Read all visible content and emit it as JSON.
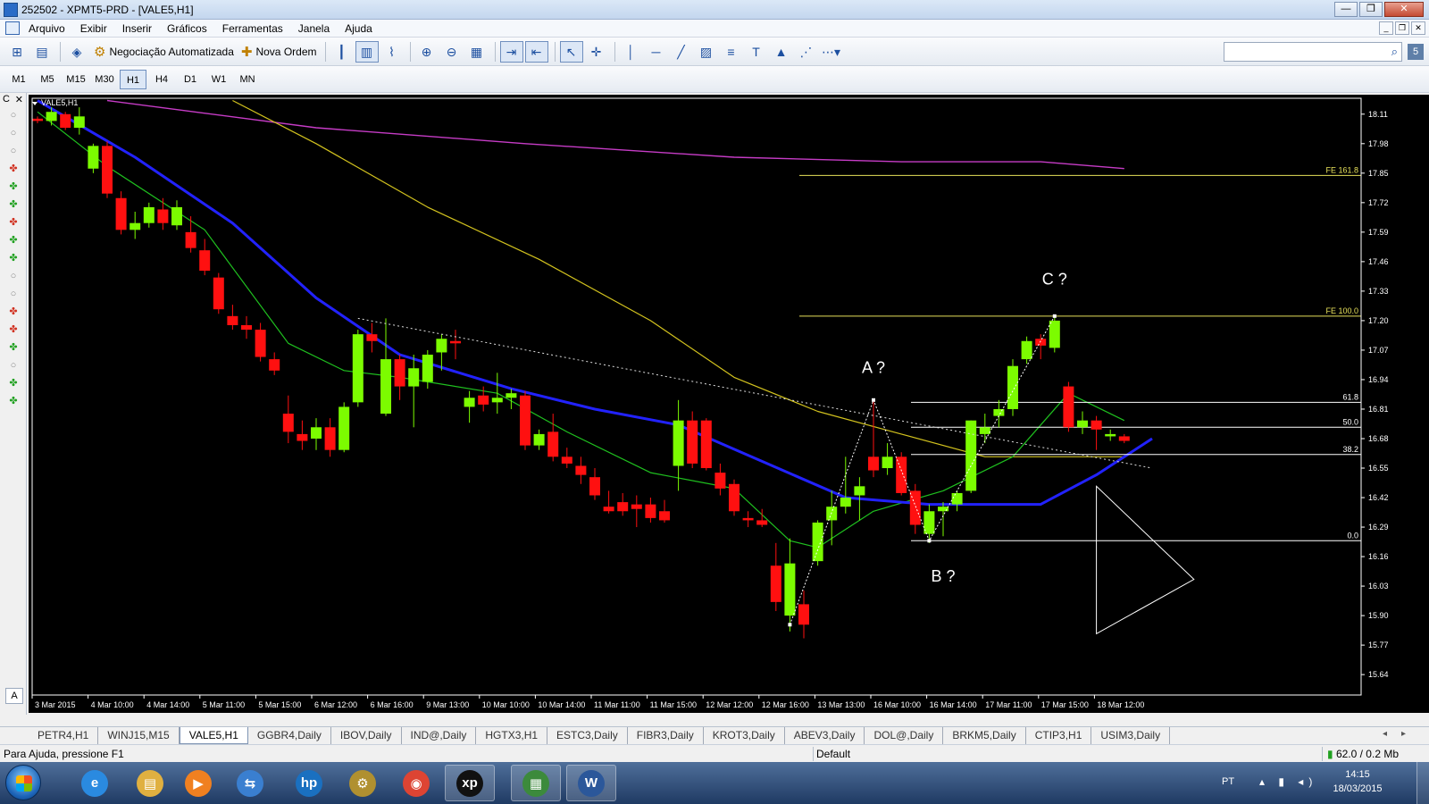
{
  "window": {
    "title": "252502 - XPMT5-PRD - [VALE5,H1]",
    "controls": {
      "minimize": "—",
      "maximize": "❐",
      "close": "✕"
    }
  },
  "menubar": {
    "items": [
      "Arquivo",
      "Exibir",
      "Inserir",
      "Gráficos",
      "Ferramentas",
      "Janela",
      "Ajuda"
    ],
    "mdi_controls": {
      "minimize": "_",
      "restore": "❐",
      "close": "✕"
    }
  },
  "toolbar": {
    "auto_trading_label": "Negociação Automatizada",
    "new_order_label": "Nova Ordem",
    "search_placeholder": "",
    "search_icon": "search-icon",
    "help_label": "5"
  },
  "timeframes": {
    "items": [
      "M1",
      "M5",
      "M15",
      "M30",
      "H1",
      "H4",
      "D1",
      "W1",
      "MN"
    ],
    "active": "H1"
  },
  "left_panel": {
    "header_label": "C",
    "close_label": "✕",
    "bottom_label": "A"
  },
  "chart_data": {
    "type": "candlestick",
    "symbol_label": "VALE5,H1",
    "ylim": [
      15.55,
      18.18
    ],
    "y_ticks": [
      "18.11",
      "17.98",
      "17.85",
      "17.72",
      "17.59",
      "17.46",
      "17.33",
      "17.20",
      "17.07",
      "16.94",
      "16.81",
      "16.68",
      "16.55",
      "16.42",
      "16.29",
      "16.16",
      "16.03",
      "15.90",
      "15.77",
      "15.64"
    ],
    "x_ticks": [
      "3 Mar 2015",
      "4 Mar 10:00",
      "4 Mar 14:00",
      "5 Mar 11:00",
      "5 Mar 15:00",
      "6 Mar 12:00",
      "6 Mar 16:00",
      "9 Mar 13:00",
      "10 Mar 10:00",
      "10 Mar 14:00",
      "11 Mar 11:00",
      "11 Mar 15:00",
      "12 Mar 12:00",
      "12 Mar 16:00",
      "13 Mar 13:00",
      "16 Mar 10:00",
      "16 Mar 14:00",
      "17 Mar 11:00",
      "17 Mar 15:00",
      "18 Mar 12:00"
    ],
    "candles": [
      [
        18.09,
        18.1,
        18.07,
        18.08
      ],
      [
        18.08,
        18.14,
        18.06,
        18.12
      ],
      [
        18.11,
        18.12,
        18.04,
        18.05
      ],
      [
        18.05,
        18.14,
        18.02,
        18.1
      ],
      [
        17.87,
        17.98,
        17.85,
        17.97
      ],
      [
        17.97,
        17.99,
        17.74,
        17.76
      ],
      [
        17.74,
        17.77,
        17.58,
        17.6
      ],
      [
        17.6,
        17.68,
        17.56,
        17.63
      ],
      [
        17.63,
        17.72,
        17.61,
        17.7
      ],
      [
        17.69,
        17.74,
        17.6,
        17.63
      ],
      [
        17.62,
        17.73,
        17.6,
        17.7
      ],
      [
        17.59,
        17.66,
        17.5,
        17.52
      ],
      [
        17.51,
        17.56,
        17.4,
        17.42
      ],
      [
        17.39,
        17.41,
        17.23,
        17.25
      ],
      [
        17.22,
        17.27,
        17.16,
        17.18
      ],
      [
        17.18,
        17.22,
        17.12,
        17.16
      ],
      [
        17.16,
        17.19,
        17.02,
        17.04
      ],
      [
        17.03,
        17.06,
        16.96,
        16.98
      ],
      [
        16.79,
        16.87,
        16.66,
        16.71
      ],
      [
        16.7,
        16.76,
        16.63,
        16.67
      ],
      [
        16.68,
        16.77,
        16.63,
        16.73
      ],
      [
        16.73,
        16.77,
        16.6,
        16.63
      ],
      [
        16.63,
        16.84,
        16.62,
        16.82
      ],
      [
        16.84,
        17.16,
        16.82,
        17.14
      ],
      [
        17.14,
        17.19,
        17.06,
        17.11
      ],
      [
        16.79,
        17.21,
        16.78,
        17.03
      ],
      [
        17.03,
        17.05,
        16.85,
        16.91
      ],
      [
        16.91,
        17.05,
        16.73,
        16.99
      ],
      [
        16.93,
        17.07,
        16.9,
        17.05
      ],
      [
        17.06,
        17.14,
        16.98,
        17.12
      ],
      [
        17.11,
        17.16,
        17.03,
        17.1
      ],
      [
        16.82,
        16.89,
        16.75,
        16.86
      ],
      [
        16.87,
        16.91,
        16.8,
        16.83
      ],
      [
        16.84,
        16.97,
        16.79,
        16.86
      ],
      [
        16.86,
        16.9,
        16.81,
        16.88
      ],
      [
        16.87,
        16.89,
        16.63,
        16.65
      ],
      [
        16.65,
        16.72,
        16.63,
        16.7
      ],
      [
        16.71,
        16.79,
        16.58,
        16.6
      ],
      [
        16.6,
        16.64,
        16.55,
        16.57
      ],
      [
        16.56,
        16.6,
        16.48,
        16.52
      ],
      [
        16.51,
        16.55,
        16.41,
        16.43
      ],
      [
        16.38,
        16.45,
        16.35,
        16.36
      ],
      [
        16.4,
        16.44,
        16.34,
        16.36
      ],
      [
        16.39,
        16.43,
        16.29,
        16.37
      ],
      [
        16.39,
        16.42,
        16.31,
        16.33
      ],
      [
        16.36,
        16.41,
        16.31,
        16.32
      ],
      [
        16.56,
        16.85,
        16.45,
        16.76
      ],
      [
        16.76,
        16.8,
        16.55,
        16.57
      ],
      [
        16.76,
        16.77,
        16.54,
        16.55
      ],
      [
        16.53,
        16.57,
        16.43,
        16.46
      ],
      [
        16.48,
        16.5,
        16.34,
        16.36
      ],
      [
        16.33,
        16.36,
        16.29,
        16.32
      ],
      [
        16.32,
        16.37,
        16.29,
        16.3
      ],
      [
        16.12,
        16.22,
        15.92,
        15.96
      ],
      [
        15.9,
        16.24,
        15.83,
        16.13
      ],
      [
        15.95,
        16.01,
        15.8,
        15.86
      ],
      [
        16.14,
        16.32,
        16.12,
        16.31
      ],
      [
        16.32,
        16.45,
        16.21,
        16.38
      ],
      [
        16.38,
        16.6,
        16.35,
        16.42
      ],
      [
        16.43,
        16.51,
        16.32,
        16.47
      ],
      [
        16.6,
        16.85,
        16.51,
        16.54
      ],
      [
        16.55,
        16.66,
        16.52,
        16.6
      ],
      [
        16.6,
        16.62,
        16.43,
        16.44
      ],
      [
        16.45,
        16.48,
        16.26,
        16.3
      ],
      [
        16.26,
        16.39,
        16.22,
        16.36
      ],
      [
        16.36,
        16.4,
        16.25,
        16.38
      ],
      [
        16.39,
        16.45,
        16.36,
        16.44
      ],
      [
        16.45,
        16.76,
        16.44,
        16.76
      ],
      [
        16.7,
        16.79,
        16.66,
        16.73
      ],
      [
        16.78,
        16.85,
        16.73,
        16.81
      ],
      [
        16.81,
        17.03,
        16.78,
        17.0
      ],
      [
        17.03,
        17.13,
        17.01,
        17.11
      ],
      [
        17.12,
        17.14,
        17.03,
        17.09
      ],
      [
        17.08,
        17.22,
        17.06,
        17.2
      ],
      [
        16.91,
        16.93,
        16.71,
        16.73
      ],
      [
        16.73,
        16.8,
        16.7,
        16.76
      ],
      [
        16.76,
        16.78,
        16.63,
        16.72
      ],
      [
        16.69,
        16.72,
        16.67,
        16.7
      ],
      [
        16.69,
        16.7,
        16.66,
        16.67
      ]
    ],
    "ma_blue": [
      [
        0,
        18.17
      ],
      [
        7,
        17.92
      ],
      [
        14,
        17.63
      ],
      [
        20,
        17.3
      ],
      [
        26,
        17.05
      ],
      [
        34,
        16.9
      ],
      [
        40,
        16.81
      ],
      [
        46,
        16.74
      ],
      [
        52,
        16.58
      ],
      [
        58,
        16.42
      ],
      [
        64,
        16.39
      ],
      [
        72,
        16.39
      ],
      [
        76,
        16.52
      ],
      [
        80,
        16.68
      ]
    ],
    "ma_green": [
      [
        0,
        18.12
      ],
      [
        5,
        17.88
      ],
      [
        12,
        17.6
      ],
      [
        18,
        17.1
      ],
      [
        22,
        16.98
      ],
      [
        26,
        16.95
      ],
      [
        33,
        16.88
      ],
      [
        38,
        16.71
      ],
      [
        44,
        16.53
      ],
      [
        50,
        16.46
      ],
      [
        54,
        16.23
      ],
      [
        56,
        16.2
      ],
      [
        60,
        16.36
      ],
      [
        65,
        16.45
      ],
      [
        70,
        16.6
      ],
      [
        74,
        16.88
      ],
      [
        78,
        16.76
      ]
    ],
    "ma_yellow": [
      [
        14,
        18.17
      ],
      [
        20,
        17.98
      ],
      [
        28,
        17.7
      ],
      [
        36,
        17.47
      ],
      [
        44,
        17.2
      ],
      [
        50,
        16.95
      ],
      [
        56,
        16.8
      ],
      [
        62,
        16.7
      ],
      [
        68,
        16.6
      ],
      [
        74,
        16.6
      ],
      [
        78,
        16.6
      ]
    ],
    "ma_magenta": [
      [
        5,
        18.17
      ],
      [
        20,
        18.05
      ],
      [
        35,
        17.98
      ],
      [
        50,
        17.92
      ],
      [
        62,
        17.9
      ],
      [
        72,
        17.9
      ],
      [
        78,
        17.87
      ]
    ],
    "trendline_dotted": [
      [
        23,
        17.21
      ],
      [
        80,
        16.55
      ]
    ],
    "zigzag": [
      [
        54,
        15.86
      ],
      [
        60,
        16.85
      ],
      [
        64,
        16.23
      ],
      [
        73,
        17.22
      ]
    ],
    "fibonacci_levels": [
      {
        "label": "FE 161.8",
        "value": 17.84
      },
      {
        "label": "FE 100.0",
        "value": 17.22
      },
      {
        "label": "61.8",
        "value": 16.84
      },
      {
        "label": "50.0",
        "value": 16.73
      },
      {
        "label": "38.2",
        "value": 16.61
      },
      {
        "label": "0.0",
        "value": 16.23
      }
    ],
    "annotations": [
      {
        "text": "A ?",
        "idx": 60,
        "value": 16.97
      },
      {
        "text": "B ?",
        "idx": 65,
        "value": 16.05
      },
      {
        "text": "C ?",
        "idx": 73,
        "value": 17.36
      }
    ],
    "triangle": [
      [
        76,
        16.47
      ],
      [
        76,
        15.82
      ],
      [
        83,
        16.06
      ]
    ]
  },
  "chart_tabs": {
    "items": [
      "PETR4,H1",
      "WINJ15,M15",
      "VALE5,H1",
      "GGBR4,Daily",
      "IBOV,Daily",
      "IND@,Daily",
      "HGTX3,H1",
      "ESTC3,Daily",
      "FIBR3,Daily",
      "KROT3,Daily",
      "ABEV3,Daily",
      "DOL@,Daily",
      "BRKM5,Daily",
      "CTIP3,H1",
      "USIM3,Daily"
    ],
    "active": "VALE5,H1",
    "arrows": "◂▸"
  },
  "statusbar": {
    "help_text": "Para Ajuda, pressione F1",
    "profile": "Default",
    "connection": "62.0 / 0.2 Mb"
  },
  "taskbar": {
    "apps": [
      {
        "name": "ie",
        "label": "e",
        "color": "#2a8ae0"
      },
      {
        "name": "explorer",
        "label": "▤",
        "color": "#e0b040"
      },
      {
        "name": "media",
        "label": "▶",
        "color": "#f08020"
      },
      {
        "name": "network",
        "label": "⇆",
        "color": "#3a7fd0"
      },
      {
        "name": "hp",
        "label": "hp",
        "color": "#1a70c0"
      },
      {
        "name": "tools",
        "label": "⚙",
        "color": "#b09030"
      },
      {
        "name": "chrome",
        "label": "◉",
        "color": "#dd4433"
      },
      {
        "name": "xp",
        "label": "xp",
        "color": "#111111"
      },
      {
        "name": "metatrader",
        "label": "▦",
        "color": "#3c8a3c"
      },
      {
        "name": "word",
        "label": "W",
        "color": "#2b579a"
      }
    ],
    "language": "PT",
    "tray_icons": "▴ ▮ ◂)",
    "time": "14:15",
    "date": "18/03/2015"
  }
}
